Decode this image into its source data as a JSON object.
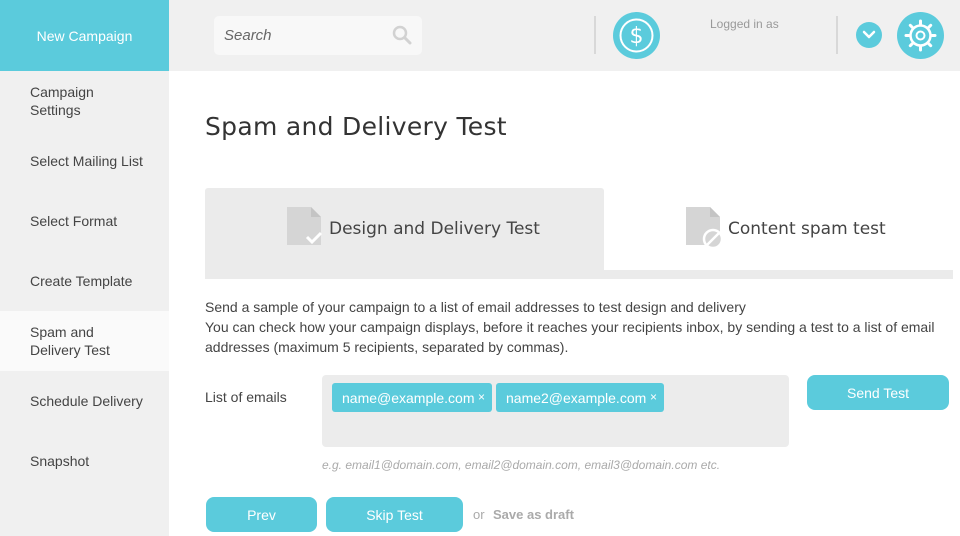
{
  "sidebar": {
    "brand": "New Campaign",
    "items": [
      {
        "label": "Campaign\nSettings"
      },
      {
        "label": "Select Mailing List"
      },
      {
        "label": "Select Format"
      },
      {
        "label": "Create Template"
      },
      {
        "label": "Spam and\nDelivery Test"
      },
      {
        "label": "Schedule Delivery"
      },
      {
        "label": "Snapshot"
      }
    ]
  },
  "topbar": {
    "search_placeholder": "Search",
    "logged_in_text": "Logged in as",
    "icons": [
      "search-icon",
      "dollar-icon",
      "chevron-down-icon",
      "gear-icon"
    ]
  },
  "main": {
    "title": "Spam and Delivery Test",
    "tabs": [
      {
        "label": "Design and Delivery Test",
        "active": true
      },
      {
        "label": "Content spam test",
        "active": false
      }
    ],
    "description_line1": "Send a sample of your campaign to a list of email addresses to test design and delivery",
    "description_line2": "You can check how your campaign displays, before it reaches your recipients inbox, by sending a test to a list of email addresses (maximum 5 recipients, separated by commas).",
    "emails_label": "List of emails",
    "emails": [
      "name@example.com",
      "name2@example.com"
    ],
    "remove_symbol": "×",
    "emails_hint": "e.g. email1@domain.com, email2@domain.com, email3@domain.com etc.",
    "send_test_label": "Send Test",
    "prev_label": "Prev",
    "skip_test_label": "Skip Test",
    "or_text": "or",
    "save_draft_label": "Save as draft"
  },
  "colors": {
    "accent": "#5bcbdc",
    "sidebar_bg": "#f0f0f0",
    "tab_active_bg": "#ebebeb"
  }
}
